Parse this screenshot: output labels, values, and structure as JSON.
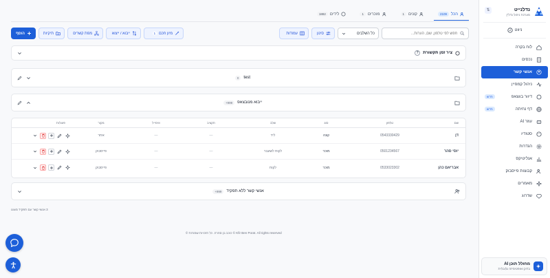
{
  "sidebar": {
    "brand_name": "נדלנייט",
    "brand_sub": "מערכת ניהול נדל\"ן",
    "nivut": "ניווט",
    "items": [
      {
        "label": "לוח בקרה",
        "icon": "home-icon"
      },
      {
        "label": "נכסים",
        "icon": "building-icon"
      },
      {
        "label": "אנשי קשר",
        "icon": "user-circle-icon",
        "active": true
      },
      {
        "label": "ניהול קמפיין",
        "icon": "activity-icon"
      },
      {
        "label": "דיוור בווצאפ",
        "icon": "chat-icon",
        "badge": "חדש"
      },
      {
        "label": "דף נחיתה",
        "icon": "globe-icon",
        "badge": "חדש"
      },
      {
        "label": "עוזר AI",
        "icon": "robot-icon"
      },
      {
        "label": "סטודיו",
        "icon": "palette-icon"
      },
      {
        "label": "הגדרות",
        "icon": "gear-icon"
      },
      {
        "label": "אנליטיקס",
        "icon": "chart-icon"
      },
      {
        "label": "קבוצות פייסבוק",
        "icon": "users-icon"
      },
      {
        "label": "מאמרים",
        "icon": "sparkle-icon"
      },
      {
        "label": "שדרוג",
        "icon": "diamond-icon"
      }
    ],
    "ai_card": {
      "title": "מחולל תוכן AI",
      "sub": "בדוק ואופטימיזה גלובלית"
    }
  },
  "tabs": [
    {
      "label": "הכל",
      "count": "2109",
      "active": true
    },
    {
      "label": "קונים",
      "count": "1"
    },
    {
      "label": "מוכרים",
      "count": "1"
    },
    {
      "label": "לידים",
      "count": "1882"
    }
  ],
  "toolbar": {
    "search_placeholder": "חפש לפי טלפון, שם, הערות...",
    "select_value": "כל השלבים",
    "filter_label": "סינון",
    "columns_label": "עמודות",
    "sort_label": "מיון חכם",
    "sort_badge": "1",
    "import_label": "ייבוא / ייצוא",
    "map_label": "מפת קשרים",
    "folders_label": "תיקיות",
    "add_label": "הוסף"
  },
  "timeline_card": {
    "title": "ציר זמן תקשורת",
    "help": "?"
  },
  "folder_test": {
    "title": "test",
    "count": "0"
  },
  "folder_import": {
    "title": "ייבוא מנובצאפ",
    "count": "999+"
  },
  "table": {
    "headers": {
      "name": "שם",
      "phone": "טלפון",
      "type": "סוג",
      "stage": "שלב",
      "tags": "תקציב",
      "email": "אימייל",
      "source": "מקור",
      "actions": "פעולות"
    },
    "rows": [
      {
        "name": "דן",
        "phone": "0543330429",
        "type": "קונה",
        "stage": "ליד",
        "tags": "—",
        "email": "—",
        "source": "אתר"
      },
      {
        "name": "יוסי סהר",
        "phone": "0501234567",
        "type": "מוכר",
        "stage": "לקוח לשעבר",
        "tags": "—",
        "email": "—",
        "source": "פייסבוק"
      },
      {
        "name": "אבריאם כהן",
        "phone": "0533023302",
        "type": "מוכר",
        "stage": "לקוח",
        "tags": "—",
        "email": "—",
        "source": "פייסבוק"
      }
    ]
  },
  "no_role_card": {
    "title": "אנשי קשר ללא תפקיד",
    "count": "999+"
  },
  "footer_count": "3 אנשי קשר עם תפקיד מוצגו",
  "copyright": "© כוכב בן סהרה. כל הזכויות שמורות © Kfir Ben Porat. All rights reserved",
  "colors": {
    "accent": "#1d5fd9",
    "danger": "#dc2626"
  }
}
